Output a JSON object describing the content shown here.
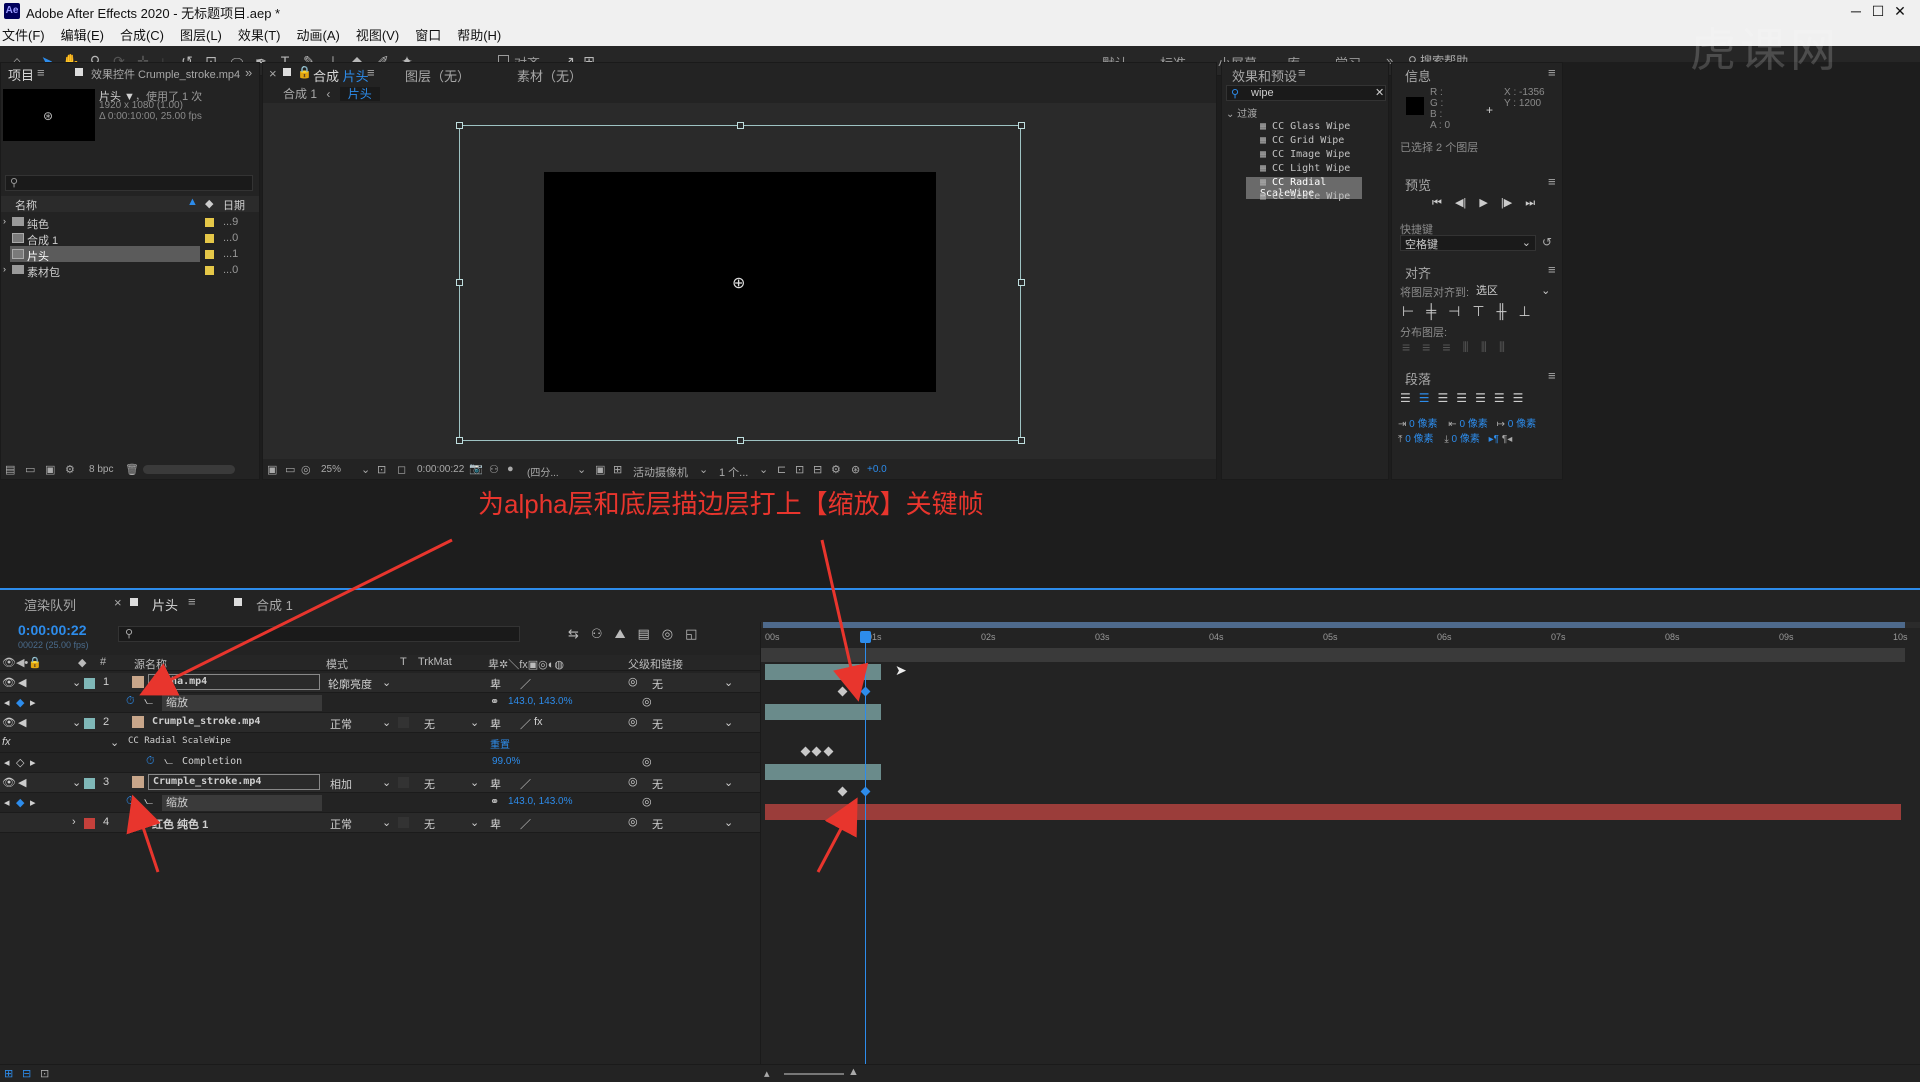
{
  "window": {
    "app_icon": "Ae",
    "title": "Adobe After Effects 2020 - 无标题项目.aep *"
  },
  "menu": [
    "文件(F)",
    "编辑(E)",
    "合成(C)",
    "图层(L)",
    "效果(T)",
    "动画(A)",
    "视图(V)",
    "窗口",
    "帮助(H)"
  ],
  "toolbar": {
    "align_label": "对齐",
    "workspaces": [
      "默认",
      "标准",
      "小屏幕",
      "库",
      "学习"
    ],
    "search_help": "搜索帮助"
  },
  "project_panel": {
    "tab_project": "项目",
    "tab_effects_controls": "效果控件 Crumple_stroke.mp4",
    "selected_name": "片头 ▼",
    "usage": "，使用了 1 次",
    "dimensions": "1920 x 1080 (1.00)",
    "duration": "Δ 0:00:10:00, 25.00 fps",
    "col_name": "名称",
    "col_date": "日期",
    "items": [
      {
        "name": "纯色",
        "type": "folder",
        "color": "#e5c748",
        "date": "...9"
      },
      {
        "name": "合成 1",
        "type": "comp",
        "color": "#e5c748",
        "date": "...0"
      },
      {
        "name": "片头",
        "type": "comp",
        "color": "#e5c748",
        "date": "...1",
        "selected": true
      },
      {
        "name": "素材包",
        "type": "folder",
        "color": "#e5c748",
        "date": "...0"
      }
    ],
    "bpc": "8 bpc"
  },
  "composition_panel": {
    "tab_prefix": "合成",
    "tab_name": "片头",
    "layer_tab": "图层（无）",
    "footage_tab": "素材（无）",
    "breadcrumb_1": "合成 1",
    "breadcrumb_2": "片头",
    "zoom": "25%",
    "timecode": "0:00:00:22",
    "resolution": "(四分...",
    "camera": "活动摄像机",
    "views": "1 个...",
    "exposure": "+0.0"
  },
  "annotation": "为alpha层和底层描边层打上【缩放】关键帧",
  "effects_presets": {
    "title": "效果和预设",
    "search": "wipe",
    "category": "过渡",
    "items": [
      "CC Glass Wipe",
      "CC Grid Wipe",
      "CC Image Wipe",
      "CC Light Wipe",
      "CC Radial ScaleWipe",
      "CC Scale Wipe"
    ],
    "selected_index": 4
  },
  "info_panel": {
    "title": "信息",
    "r": "R :",
    "g": "G :",
    "b": "B :",
    "a": "A : 0",
    "x": "X : -1356",
    "y": "Y : 1200",
    "selected": "已选择 2 个图层"
  },
  "preview_panel": {
    "title": "预览",
    "shortcut_label": "快捷键",
    "shortcut_value": "空格键"
  },
  "align_panel": {
    "title": "对齐",
    "align_to_label": "将图层对齐到:",
    "align_to_value": "选区",
    "distribute_label": "分布图层:"
  },
  "paragraph_panel": {
    "title": "段落",
    "px1": "0 像素",
    "px2": "0 像素",
    "px3": "0 像素",
    "px4": "0 像素",
    "px5": "0 像素"
  },
  "timeline": {
    "tab_render": "渲染队列",
    "tab_comp": "片头",
    "tab_comp2": "合成 1",
    "timecode": "0:00:00:22",
    "fps_sub": "00022 (25.00 fps)",
    "col_source": "源名称",
    "col_mode": "模式",
    "col_t": "T",
    "col_trkmat": "TrkMat",
    "col_parent": "父级和链接",
    "ruler": [
      "00s",
      "01s",
      "02s",
      "03s",
      "04s",
      "05s",
      "06s",
      "07s",
      "08s",
      "09s",
      "10s"
    ],
    "layers": [
      {
        "num": "1",
        "name": "alpha.mp4",
        "mode": "轮廓亮度",
        "trkmat": "",
        "parent": "无",
        "color": "#7fb7b7"
      },
      {
        "prop": "缩放",
        "value": "143.0, 143.0%"
      },
      {
        "num": "2",
        "name": "Crumple_stroke.mp4",
        "mode": "正常",
        "trkmat": "无",
        "parent": "无",
        "color": "#7fb7b7"
      },
      {
        "effect": "CC Radial ScaleWipe",
        "reset": "重置"
      },
      {
        "prop": "Completion",
        "value": "99.0%"
      },
      {
        "num": "3",
        "name": "Crumple_stroke.mp4",
        "mode": "相加",
        "trkmat": "无",
        "parent": "无",
        "color": "#7fb7b7"
      },
      {
        "prop": "缩放",
        "value": "143.0, 143.0%"
      },
      {
        "num": "4",
        "name": "红色 纯色 1",
        "mode": "正常",
        "trkmat": "无",
        "parent": "无",
        "color": "#c4403b"
      }
    ]
  },
  "colors": {
    "accent": "#2d8ceb",
    "annotation": "#e8352d",
    "layer_bar": "#6a8b8b",
    "solid_bar": "#9b3d3a"
  }
}
